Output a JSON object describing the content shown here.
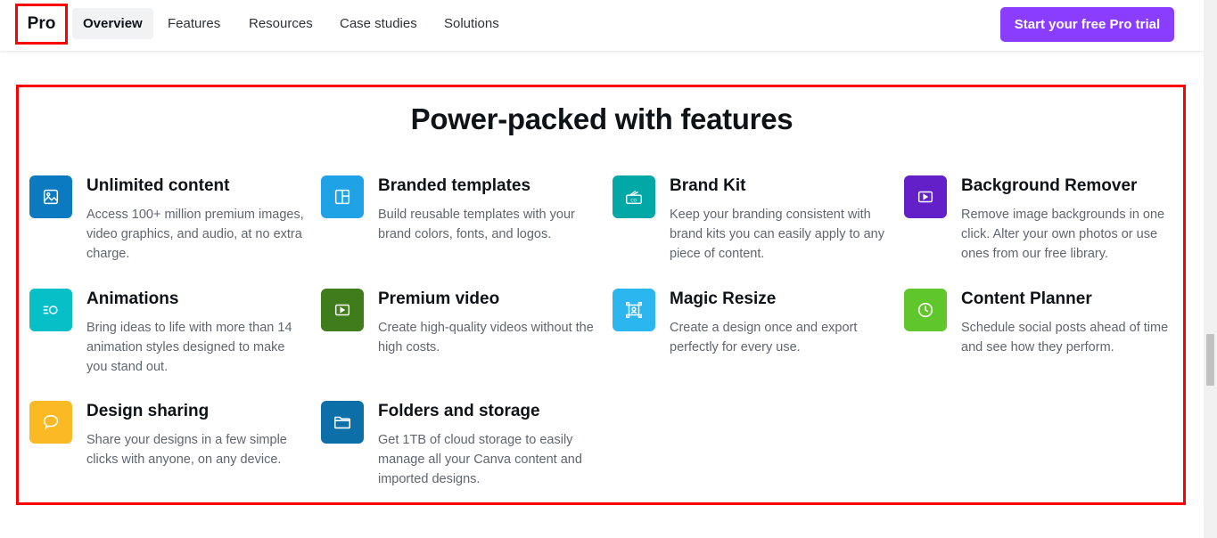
{
  "nav": {
    "brand": "Pro",
    "tabs": [
      "Overview",
      "Features",
      "Resources",
      "Case studies",
      "Solutions"
    ],
    "cta": "Start your free Pro trial"
  },
  "section": {
    "title": "Power-packed with features",
    "features": [
      {
        "title": "Unlimited content",
        "desc": "Access 100+ million premium images, video graphics, and audio, at no extra charge.",
        "icon": "image-icon",
        "color": "#0b7ac0"
      },
      {
        "title": "Branded templates",
        "desc": "Build reusable templates with your brand colors, fonts, and logos.",
        "icon": "template-icon",
        "color": "#1fa3e6"
      },
      {
        "title": "Brand Kit",
        "desc": "Keep your branding consistent with brand kits you can easily apply to any piece of content.",
        "icon": "brand-kit-icon",
        "color": "#01a8a5"
      },
      {
        "title": "Background Remover",
        "desc": "Remove image backgrounds in one click. Alter your own photos or use ones from our free library.",
        "icon": "background-remover-icon",
        "color": "#6420c8"
      },
      {
        "title": "Animations",
        "desc": "Bring ideas to life with more than 14 animation styles designed to make you stand out.",
        "icon": "animation-icon",
        "color": "#07bfc6"
      },
      {
        "title": "Premium video",
        "desc": "Create high-quality videos without the high costs.",
        "icon": "video-icon",
        "color": "#3f7d1c"
      },
      {
        "title": "Magic Resize",
        "desc": "Create a design once and export perfectly for every use.",
        "icon": "resize-icon",
        "color": "#2bb6f0"
      },
      {
        "title": "Content Planner",
        "desc": "Schedule social posts ahead of time and see how they perform.",
        "icon": "clock-icon",
        "color": "#5fc72c"
      },
      {
        "title": "Design sharing",
        "desc": "Share your designs in a few simple clicks with anyone, on any device.",
        "icon": "chat-bubble-icon",
        "color": "#fbb924"
      },
      {
        "title": "Folders and storage",
        "desc": "Get 1TB of cloud storage to easily manage all your Canva content and imported designs.",
        "icon": "folder-icon",
        "color": "#0d6fa8"
      }
    ]
  }
}
